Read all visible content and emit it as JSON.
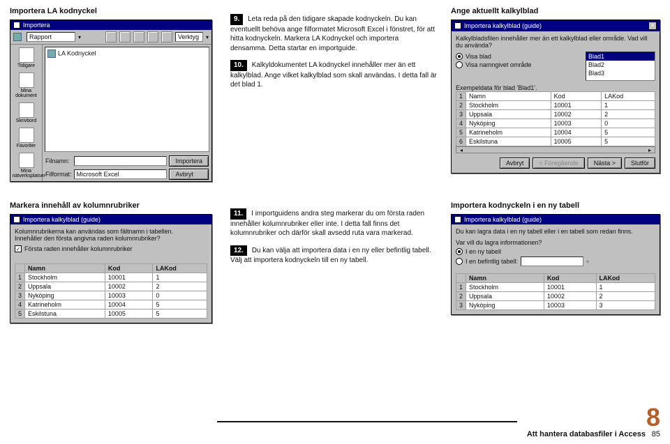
{
  "col1": {
    "heading1": "Importera LA kodnyckel",
    "importWin": {
      "title": "Importera",
      "toolbar": {
        "lookIn": "Rapport",
        "verktyg": "Verktyg"
      },
      "sidebar": [
        "Tidigare",
        "Mina dokument",
        "Skrivbord",
        "Favoriter",
        "Mina nätverksplatser"
      ],
      "file": "LA Kodnyckel",
      "labelFilename": "Filnamn:",
      "labelFiletype": "Filformat:",
      "filetype": "Microsoft Excel",
      "btnImport": "Importera",
      "btnCancel": "Avbryt"
    },
    "heading2": "Markera innehåll av kolumnrubriker",
    "wiz2": {
      "title": "Importera kalkylblad (guide)",
      "intro1": "Kolumnrubrikerna kan användas som fältnamn i tabellen.",
      "intro2": "Innehåller den första angivna raden kolumnrubriker?",
      "check": "Första raden innehåller kolumnrubriker",
      "cols": [
        "Namn",
        "Kod",
        "LAKod"
      ],
      "rows": [
        [
          "1",
          "Stockholm",
          "10001",
          "1"
        ],
        [
          "2",
          "Uppsala",
          "10002",
          "2"
        ],
        [
          "3",
          "Nyköping",
          "10003",
          "0"
        ],
        [
          "4",
          "Katrineholm",
          "10004",
          "5"
        ],
        [
          "5",
          "Eskilstuna",
          "10005",
          "5"
        ]
      ]
    }
  },
  "col2": {
    "step9": {
      "num": "9.",
      "text": "Leta reda på den tidigare skapade kodnyckeln. Du kan eventuellt behöva ange filformatet Microsoft Excel i fönstret, för att hitta kodnyckeln. Markera LA Kodnyckel och importera densamma. Detta startar en importguide."
    },
    "step10": {
      "num": "10.",
      "text": "Kalkyldokumentet LA kodnyckel innehåller mer än ett kalkylblad. Ange vilket kalkylblad som skall användas. I detta fall är det blad 1."
    },
    "step11": {
      "num": "11.",
      "text": "I importguidens andra steg markerar du om första raden innehåller kolumnrubriker eller inte. I detta fall finns det kolumnrubriker och därför skall avsedd ruta vara markerad."
    },
    "step12": {
      "num": "12.",
      "text": "Du kan välja att importera data i en ny eller befintlig tabell. Välj att importera kodnyckeln till en ny tabell."
    }
  },
  "col3": {
    "heading1": "Ange aktuellt kalkylblad",
    "wiz1": {
      "title": "Importera kalkylblad (guide)",
      "intro": "Kalkylbladsfilen innehåller mer än ett kalkylblad eller område. Vad vill du använda?",
      "radio1": "Visa blad",
      "radio2": "Visa namngivet område",
      "sheets": [
        "Blad1",
        "Blad2",
        "Blad3"
      ],
      "exempel": "Exempeldata för blad 'Blad1'.",
      "cols": [
        "Namn",
        "Kod",
        "LAKod"
      ],
      "rows": [
        [
          "1",
          "Namn",
          "Kod",
          "LAKod"
        ],
        [
          "2",
          "Stockholm",
          "10001",
          "1"
        ],
        [
          "3",
          "Uppsala",
          "10002",
          "2"
        ],
        [
          "4",
          "Nyköping",
          "10003",
          "0"
        ],
        [
          "5",
          "Katrineholm",
          "10004",
          "5"
        ],
        [
          "6",
          "Eskilstuna",
          "10005",
          "5"
        ]
      ],
      "btnCancel": "Avbryt",
      "btnPrev": "< Föregående",
      "btnNext": "Nästa >",
      "btnFinish": "Slutför"
    },
    "heading2": "Importera kodnyckeln i en ny tabell",
    "wiz3": {
      "title": "Importera kalkylblad (guide)",
      "intro": "Du kan lagra data i en ny tabell eller i en tabell som redan finns.",
      "q": "Var vill du lagra informationen?",
      "opt1": "I en ny tabell",
      "opt2": "I en befintlig tabell:",
      "cols": [
        "Namn",
        "Kod",
        "LAKod"
      ],
      "rows": [
        [
          "1",
          "Stockholm",
          "10001",
          "1"
        ],
        [
          "2",
          "Uppsala",
          "10002",
          "2"
        ],
        [
          "3",
          "Nyköping",
          "10003",
          "3"
        ]
      ]
    }
  },
  "footer": {
    "chapter": "Att hantera databasfiler i Access",
    "chapnum": "8",
    "page": "85"
  }
}
